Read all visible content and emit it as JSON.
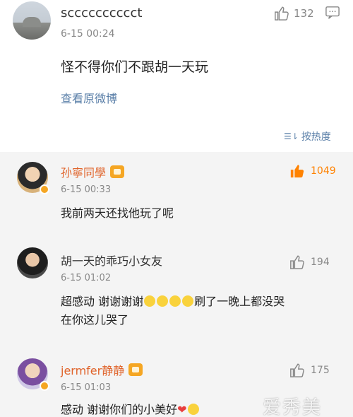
{
  "post": {
    "username": "scccccccccct",
    "time": "6-15 00:24",
    "content": "怪不得你们不跟胡一天玩",
    "view_original": "查看原微博",
    "like_count": "132",
    "sort_label": "按热度"
  },
  "comments": [
    {
      "username": "孙寧同學",
      "time": "6-15 00:33",
      "text": "我前两天还找他玩了呢",
      "likes": "1049",
      "hot": true
    },
    {
      "username": "胡一天的乖巧小女友",
      "time": "6-15 01:02",
      "text_line1_a": "超感动 谢谢谢谢",
      "text_line1_b": "刷了一晚上都没哭",
      "text_line2": "在你这儿哭了",
      "likes": "194",
      "hot": false
    },
    {
      "username": "jermfer静静",
      "time": "6-15 01:03",
      "text": "感动 谢谢你们的小美好",
      "likes": "175",
      "hot": false
    }
  ],
  "watermark": "爱秀美",
  "icons": {
    "like": "thumbs-up-icon",
    "comment": "comment-icon",
    "sort": "sort-icon",
    "badge": "member-badge-icon"
  },
  "colors": {
    "link": "#5a7fa8",
    "hot_like": "#ff8200",
    "background": "#f4f4f4"
  }
}
